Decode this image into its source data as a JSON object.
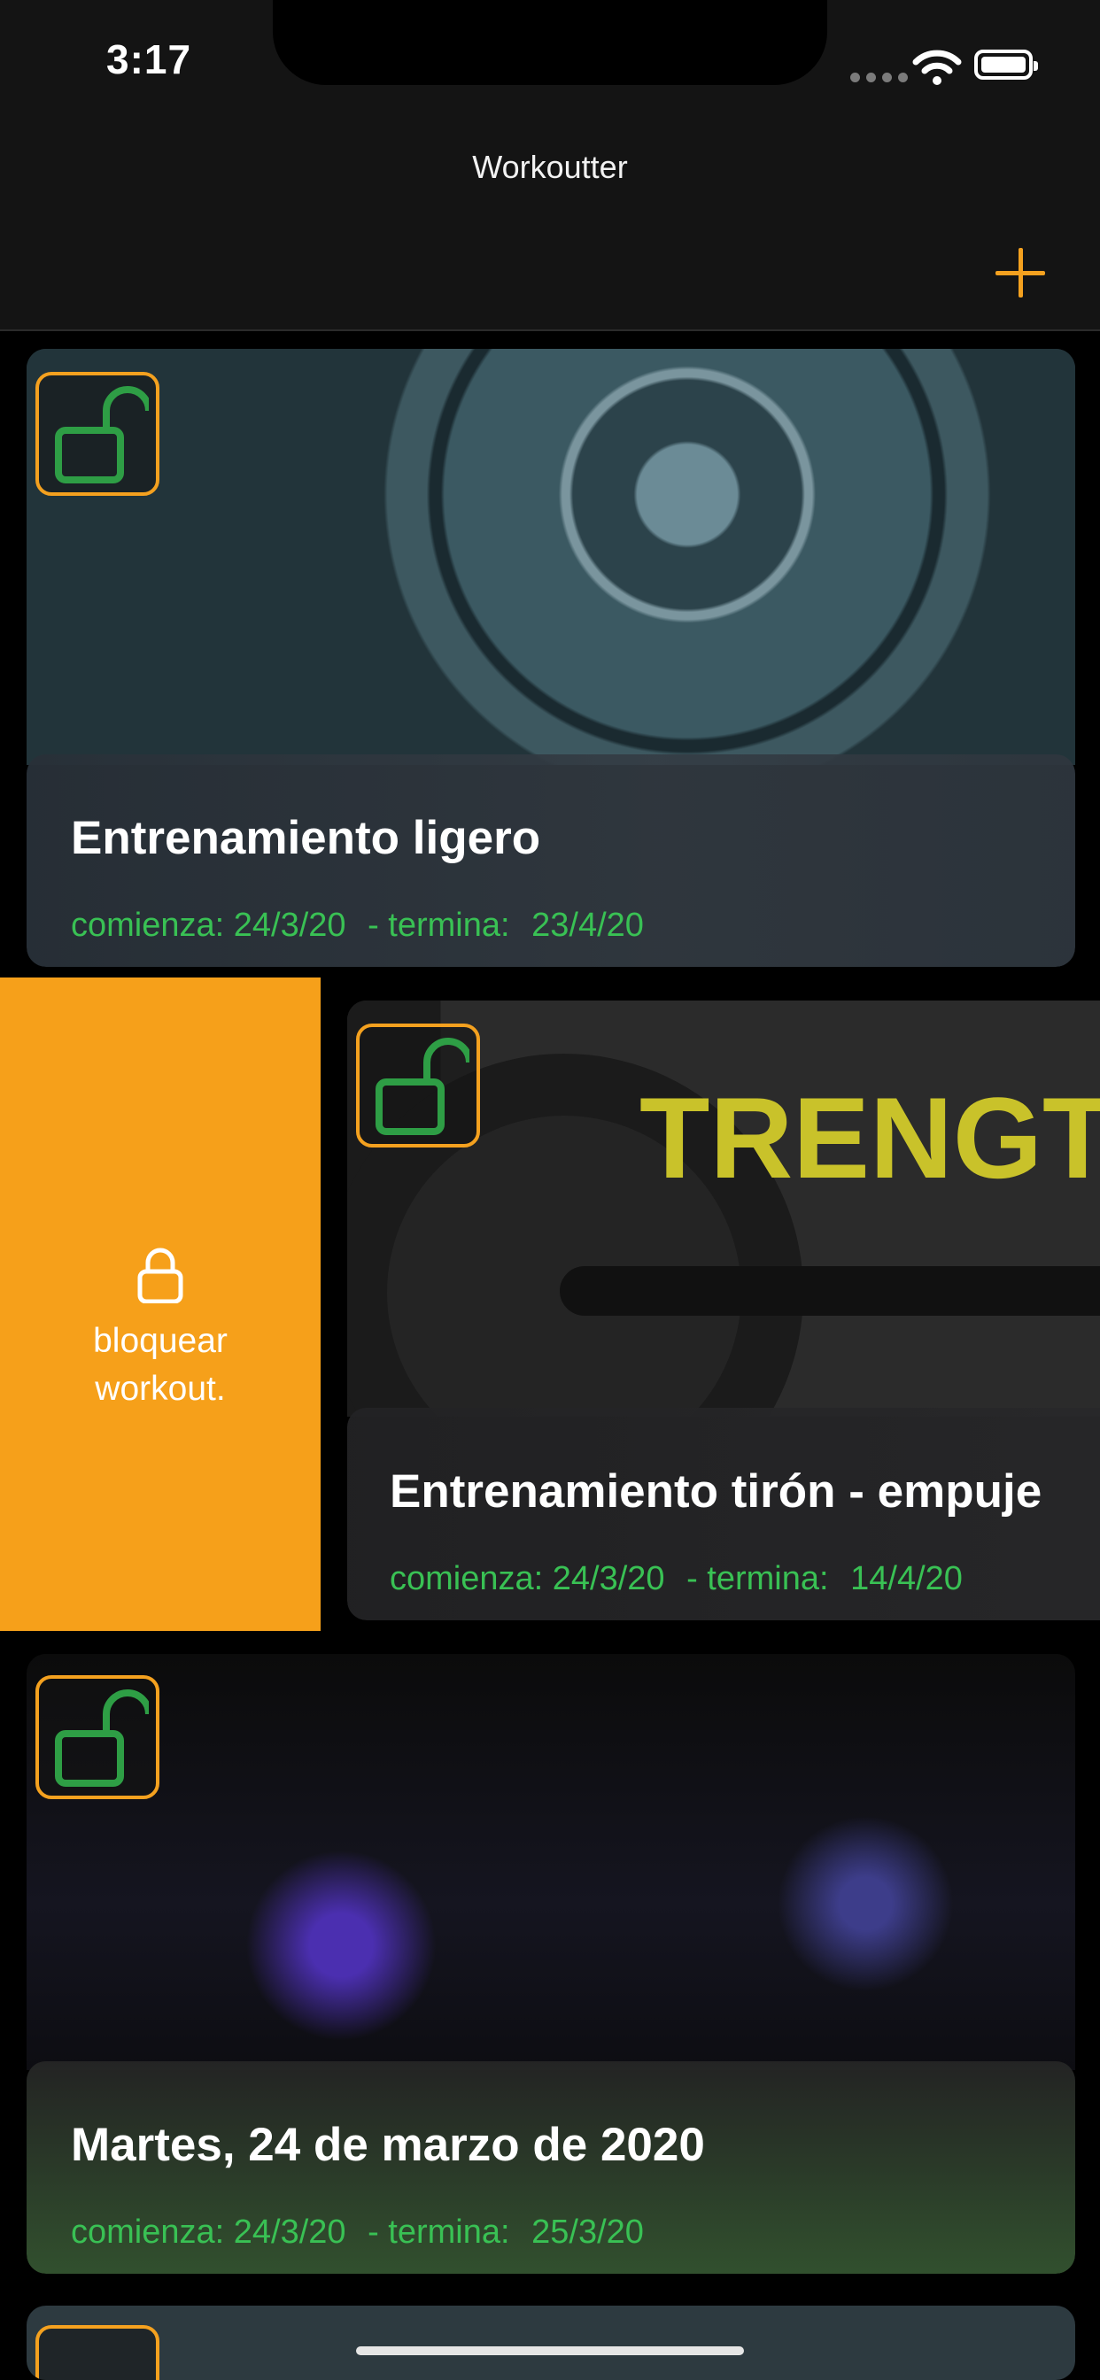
{
  "status_bar": {
    "time": "3:17"
  },
  "nav": {
    "title": "Workoutter",
    "add_icon": "plus-icon"
  },
  "swipe_action": {
    "label_line1": "bloquear",
    "label_line2": "workout.",
    "icon": "lock-icon",
    "color": "#F6A01A"
  },
  "workouts": [
    {
      "title": "Entrenamiento ligero",
      "starts_label": "comienza: 24/3/20",
      "ends_label": "- termina:",
      "ends_value": "23/4/20",
      "image": "weight-plate-photo"
    },
    {
      "title": "Entrenamiento tirón - empuje",
      "starts_label": "comienza: 24/3/20",
      "ends_label": "- termina:",
      "ends_value": "14/4/20",
      "image": "strength-wall-plate-photo"
    },
    {
      "title": "Martes, 24 de marzo de 2020",
      "starts_label": "comienza: 24/3/20",
      "ends_label": "- termina:",
      "ends_value": "25/3/20",
      "image": "gym-interior-photo"
    }
  ],
  "colors": {
    "accent": "#F4A11F",
    "date_green": "#39C154",
    "unlock_icon_green": "#2E9E45"
  }
}
